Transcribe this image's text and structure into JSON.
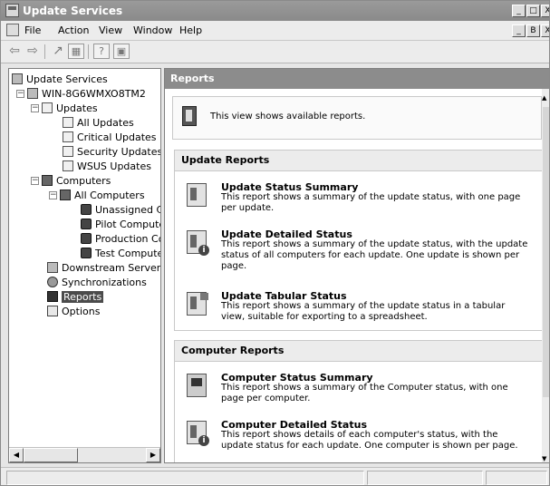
{
  "window": {
    "title": "Update Services",
    "controls": [
      "_",
      "□",
      "X"
    ],
    "mdi_controls": [
      "_",
      "B",
      "X"
    ]
  },
  "menu": [
    "File",
    "Action",
    "View",
    "Window",
    "Help"
  ],
  "toolbar": {
    "back": "⇦",
    "forward": "⇨",
    "up": "↗",
    "show_tree": "▦",
    "help": "?",
    "console": "▣"
  },
  "tree": {
    "root": "Update Services",
    "server": "WIN-8G6WMXO8TM2",
    "updates": "Updates",
    "all_updates": "All Updates",
    "critical_updates": "Critical Updates",
    "security_updates": "Security Updates",
    "wsus_updates": "WSUS Updates",
    "computers": "Computers",
    "all_computers": "All Computers",
    "unassigned": "Unassigned Cc",
    "pilot": "Pilot Computer",
    "production": "Production Coi",
    "test": "Test Computei",
    "downstream": "Downstream Servers",
    "synchronizations": "Synchronizations",
    "reports": "Reports",
    "options": "Options",
    "expand_minus": "−"
  },
  "scroll": {
    "left": "◀",
    "right": "▶",
    "up": "▲",
    "down": "▼"
  },
  "reports_pane": {
    "header": "Reports",
    "intro": "This view shows available reports.",
    "update_section": "Update Reports",
    "update_reports": [
      {
        "title": "Update Status Summary",
        "desc": "This report shows a summary of the update status, with one page per update."
      },
      {
        "title": "Update Detailed Status",
        "desc": "This report shows a summary of the update status, with the update status of all computers for each update. One update is shown per page."
      },
      {
        "title": "Update Tabular Status",
        "desc": "This report shows a summary of the update status in a tabular view, suitable for exporting to a spreadsheet."
      }
    ],
    "computer_section": "Computer Reports",
    "computer_reports": [
      {
        "title": "Computer Status Summary",
        "desc": "This report shows a summary of the Computer status, with one page per computer."
      },
      {
        "title": "Computer Detailed Status",
        "desc": "This report shows details of each computer's status, with the update status for each update. One computer is shown per page."
      }
    ]
  }
}
